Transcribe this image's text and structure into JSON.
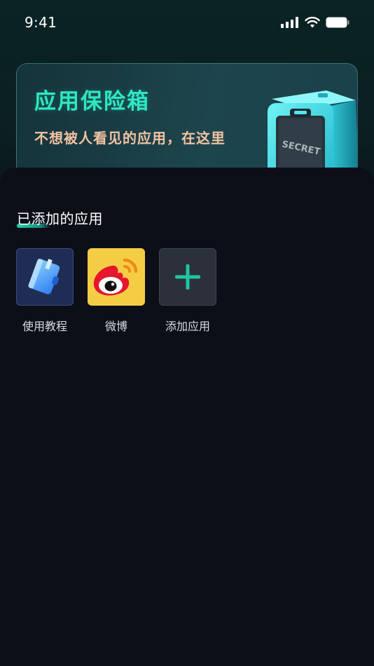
{
  "status_bar": {
    "time": "9:41",
    "icons": [
      "signal-icon",
      "wifi-icon",
      "battery-icon"
    ]
  },
  "banner": {
    "title": "应用保险箱",
    "subtitle": "不想被人看见的应用，在这里",
    "safe_label": "SECRET",
    "colors": {
      "title": "#2de8c4",
      "subtitle": "#f3c3a2"
    }
  },
  "section": {
    "title": "已添加的应用",
    "accent": "#22d3a9"
  },
  "apps": [
    {
      "label": "使用教程",
      "icon": "tutorial-book-icon"
    },
    {
      "label": "微博",
      "icon": "weibo-icon"
    },
    {
      "label": "添加应用",
      "icon": "plus-icon"
    }
  ]
}
